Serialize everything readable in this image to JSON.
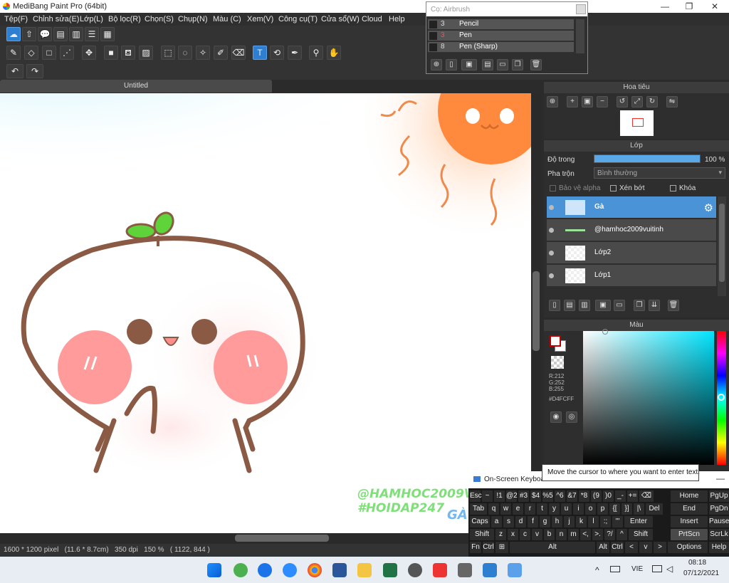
{
  "window": {
    "title": "MediBang Paint Pro (64bit)",
    "min": "—",
    "max": "❐",
    "close": "✕"
  },
  "menu": [
    "Tệp(F)",
    "Chỉnh sửa(E)",
    "Lớp(L)",
    "Bộ lọc(R)",
    "Chọn(S)",
    "Chụp(N)",
    "Màu (C)",
    "Xem(V)",
    "Công cụ(T)",
    "Cửa sổ(W)",
    "Cloud",
    "Help"
  ],
  "brush_popup": {
    "title": "Cọ: Airbrush",
    "items": [
      {
        "size": "3",
        "name": "Pencil"
      },
      {
        "size": "3",
        "name": "Pen"
      },
      {
        "size": "8",
        "name": "Pen (Sharp)"
      }
    ]
  },
  "document": {
    "tab": "Untitled"
  },
  "status": {
    "text": "1600 * 1200 pixel   (11.6 * 8.7cm)   350 dpi   150 %   ( 1122, 844 )"
  },
  "navigator": {
    "title": "Hoa tiêu"
  },
  "layers": {
    "title": "Lớp",
    "opacity_label": "Độ trong",
    "opacity_value": "100 %",
    "opacity": 1.0,
    "blend_label": "Pha trộn",
    "blend_value": "Bình thường",
    "protect_alpha": "Bảo vệ alpha",
    "clipping": "Xén bớt",
    "lock": "Khóa",
    "items": [
      {
        "name": "Gà",
        "selected": true
      },
      {
        "name": "@hamhoc2009vuitinh",
        "selected": false
      },
      {
        "name": "Lớp2",
        "selected": false
      },
      {
        "name": "Lớp1",
        "selected": false
      }
    ]
  },
  "color": {
    "title": "Màu",
    "r": "R:212",
    "g": "G:252",
    "b": "B:255",
    "hex": "#D4FCFF",
    "fg": "#ffffff",
    "fg_border": "#c00000"
  },
  "canvas_text": {
    "line1": "@HAMHOC2009VUITINH",
    "line2": "#HOIDAP247",
    "line3": "GÀ"
  },
  "osk": {
    "title": "On-Screen Keyboard",
    "tooltip": "Move the cursor to where you want to enter text.",
    "close": "—",
    "row1": [
      "Esc",
      "~",
      "!1",
      "@2",
      "#3",
      "$4",
      "%5",
      "^6",
      "&7",
      "*8",
      "(9",
      ")0",
      "_-",
      "+=",
      "⌫"
    ],
    "row2": [
      "Tab",
      "q",
      "w",
      "e",
      "r",
      "t",
      "y",
      "u",
      "i",
      "o",
      "p",
      "{[",
      "}]",
      "|\\",
      "Del"
    ],
    "row3": [
      "Caps",
      "a",
      "s",
      "d",
      "f",
      "g",
      "h",
      "j",
      "k",
      "l",
      ":;",
      "\"'",
      "Enter"
    ],
    "row4": [
      "Shift",
      "z",
      "x",
      "c",
      "v",
      "b",
      "n",
      "m",
      "<,",
      ">.",
      "?/",
      "^",
      "Shift"
    ],
    "row5": [
      "Fn",
      "Ctrl",
      "⊞",
      "Alt",
      "Alt",
      "Ctrl",
      "<",
      "v",
      ">",
      "▤"
    ],
    "nav": [
      [
        "Home",
        "PgUp"
      ],
      [
        "End",
        "PgDn"
      ],
      [
        "Insert",
        "Pause"
      ],
      [
        "PrtScn",
        "ScrLk"
      ],
      [
        "Options",
        "Help"
      ]
    ]
  },
  "taskbar": {
    "lang": "VIE",
    "time": "08:18",
    "date": "07/12/2021"
  }
}
